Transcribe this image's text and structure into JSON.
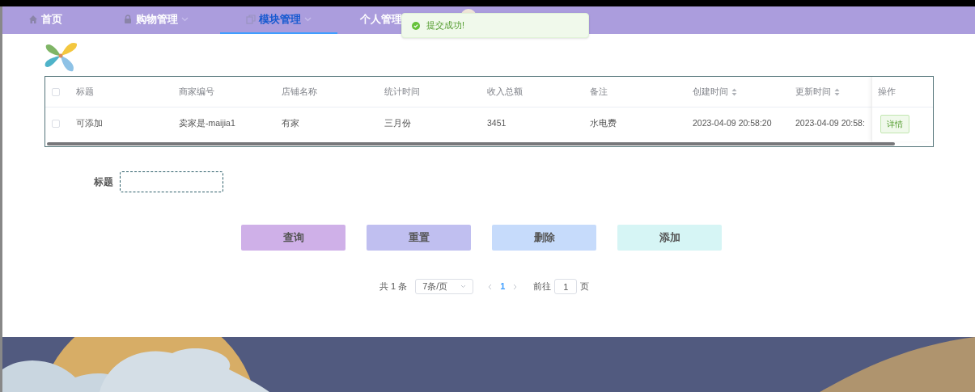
{
  "nav": {
    "items": [
      {
        "label": "首页",
        "selected": false,
        "has_menu": false
      },
      {
        "label": "购物管理",
        "selected": false,
        "has_menu": true
      },
      {
        "label": "模块管理",
        "selected": true,
        "has_menu": true
      },
      {
        "label": "个人管理",
        "selected": false,
        "has_menu": false
      }
    ]
  },
  "toast": {
    "message": "提交成功!"
  },
  "table": {
    "all_checked": false,
    "columns": [
      {
        "label": "标题",
        "sortable": false
      },
      {
        "label": "商家编号",
        "sortable": false
      },
      {
        "label": "店铺名称",
        "sortable": false
      },
      {
        "label": "统计时间",
        "sortable": false
      },
      {
        "label": "收入总额",
        "sortable": false
      },
      {
        "label": "备注",
        "sortable": false
      },
      {
        "label": "创建时间",
        "sortable": true
      },
      {
        "label": "更新时间",
        "sortable": true
      }
    ],
    "action_header": "操作",
    "rows": [
      {
        "checked": false,
        "cells": [
          "可添加",
          "卖家是-maijia1",
          "有家",
          "三月份",
          "3451",
          "水电费",
          "2023-04-09 20:58:20",
          "2023-04-09 20:58:"
        ],
        "action": "详情"
      }
    ]
  },
  "search": {
    "label": "标题"
  },
  "buttons": [
    {
      "label": "查询",
      "color": "#cfb0e8"
    },
    {
      "label": "重置",
      "color": "#c0bff0"
    },
    {
      "label": "删除",
      "color": "#c6dbfb"
    },
    {
      "label": "添加",
      "color": "#d6f5f5"
    }
  ],
  "pagination": {
    "total": "共 1 条",
    "page_size": "7条/页",
    "pages": [
      {
        "label": "1",
        "selected": true
      }
    ],
    "goto_label": "前往",
    "goto_value": "1",
    "page_suffix": "页"
  }
}
